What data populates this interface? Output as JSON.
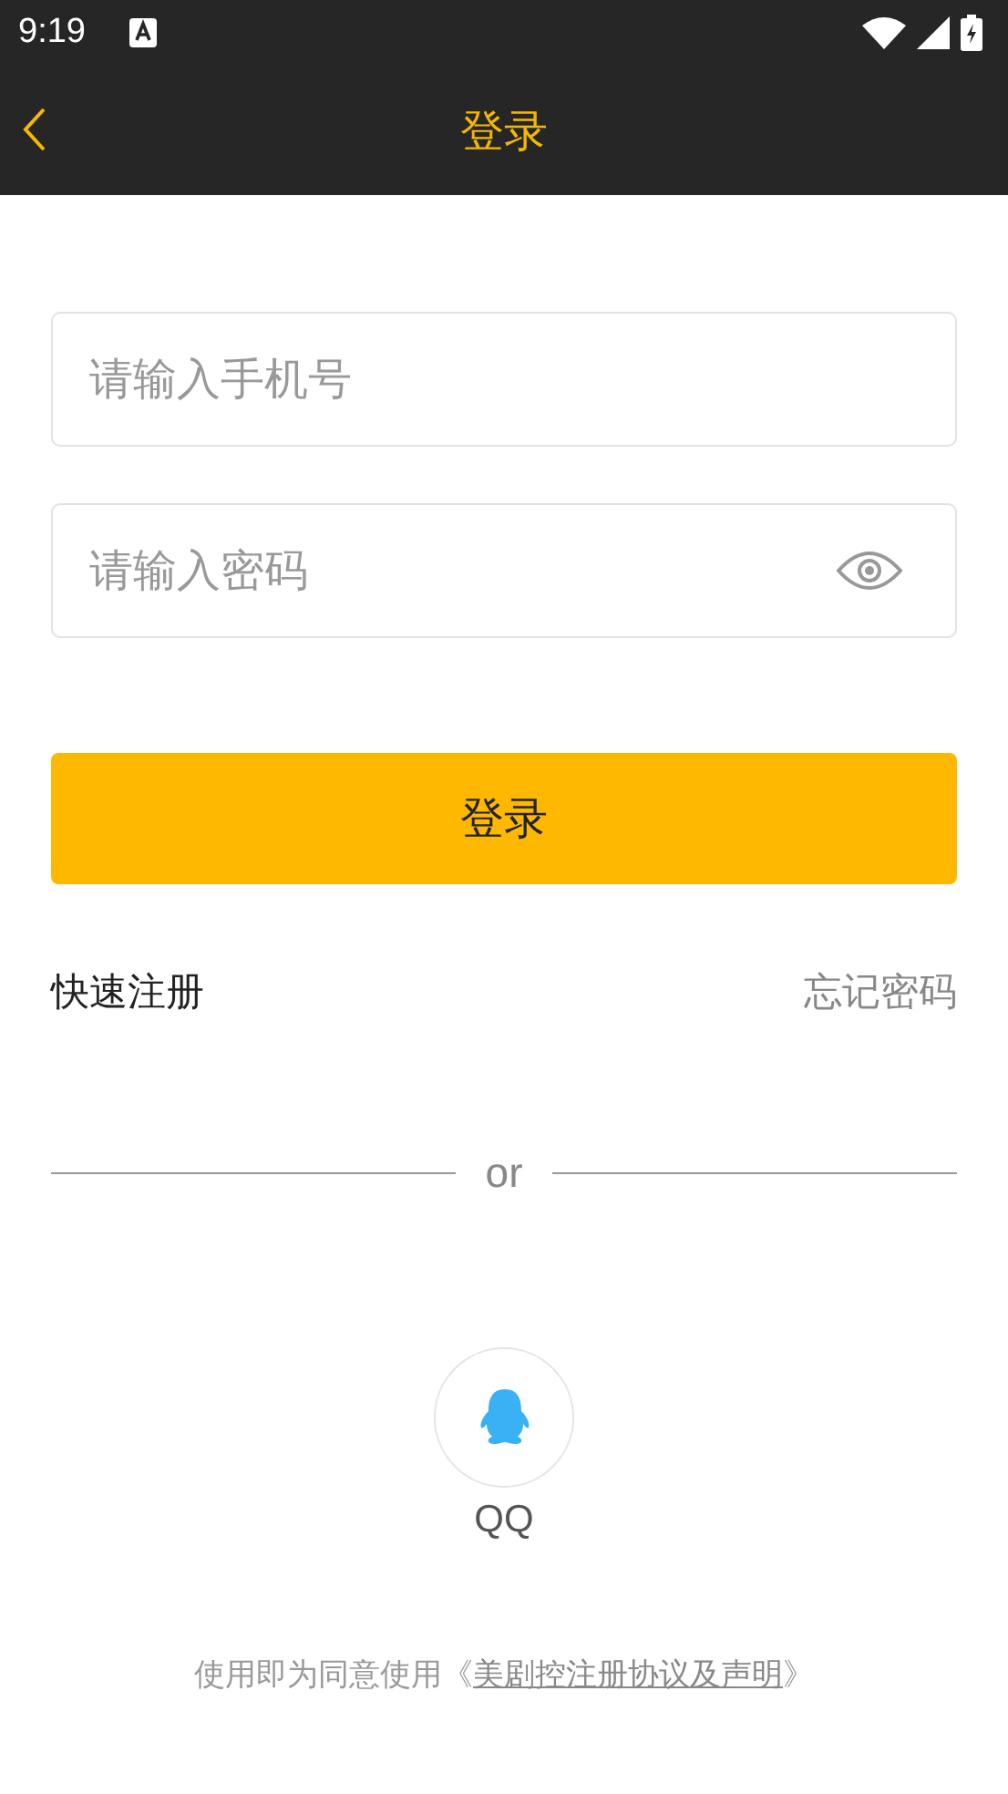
{
  "status_bar": {
    "time": "9:19"
  },
  "app_bar": {
    "title": "登录"
  },
  "phone_field": {
    "placeholder": "请输入手机号"
  },
  "password_field": {
    "placeholder": "请输入密码"
  },
  "login_button": {
    "label": "登录"
  },
  "links": {
    "register": "快速注册",
    "forgot": "忘记密码"
  },
  "divider": {
    "label": "or"
  },
  "social": [
    {
      "label": "QQ"
    }
  ],
  "agreement": {
    "prefix": "使用即为同意使用《",
    "link": "美剧控注册协议及声明",
    "suffix": "》"
  }
}
